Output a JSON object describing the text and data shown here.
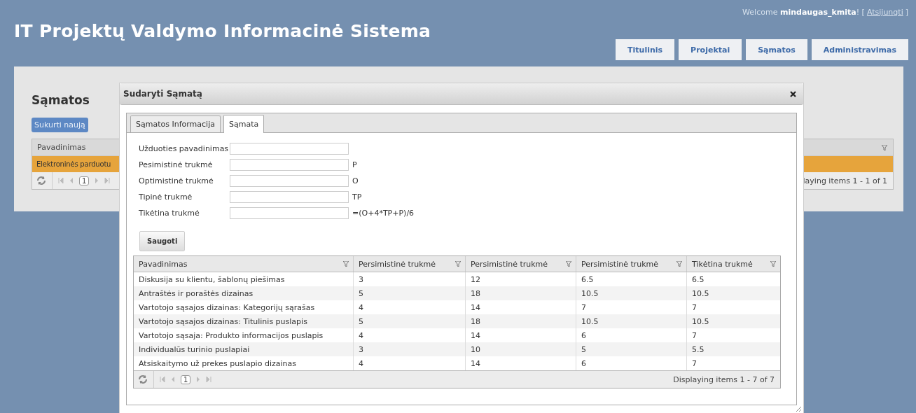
{
  "header": {
    "title": "IT Projektų Valdymo Informacinė Sistema",
    "welcome": "Welcome **mindaugas_kmita**! [",
    "logout_link": "Atsijungti",
    "welcome_end": "]"
  },
  "nav": [
    {
      "label": "Titulinis"
    },
    {
      "label": "Projektai"
    },
    {
      "label": "Sąmatos"
    },
    {
      "label": "Administravimas"
    }
  ],
  "page": {
    "heading": "Sąmatos",
    "create_button": "Sukurti naują",
    "grid": {
      "columns": [
        "Pavadinimas"
      ],
      "rows": [
        {
          "cells": [
            "Elektroninės parduotu"
          ],
          "selected": true
        }
      ],
      "pager": {
        "page": "1",
        "info": "laying items 1 - 1 of 1"
      }
    }
  },
  "dialog": {
    "title": "Sudaryti Sąmatą",
    "tabs": [
      {
        "label": "Sąmatos Informacija",
        "selected": false
      },
      {
        "label": "Sąmata",
        "selected": true
      }
    ],
    "fields": [
      {
        "label": "Užduoties pavadinimas"
      },
      {
        "label": "Pesimistinė trukmė",
        "suffix": "P"
      },
      {
        "label": "Optimistinė trukmė",
        "suffix": "O"
      },
      {
        "label": "Tipinė trukmė",
        "suffix": "TP"
      },
      {
        "label": "Tikėtina trukmė",
        "suffix": "=(O+4*TP+P)/6"
      }
    ],
    "save_button": "Saugoti",
    "grid": {
      "columns": [
        "Pavadinimas",
        "Persimistinė trukmė",
        "Persimistinė trukmė",
        "Persimistinė trukmė",
        "Tikėtina trukmė"
      ],
      "rows": [
        [
          "Diskusija su klientu, šablonų piešimas",
          "3",
          "12",
          "6.5",
          "6.5"
        ],
        [
          "Antraštės ir poraštės dizainas",
          "5",
          "18",
          "10.5",
          "10.5"
        ],
        [
          "Vartotojo sąsajos dizainas: Kategorijų sąrašas",
          "4",
          "14",
          "7",
          "7"
        ],
        [
          "Vartotojo sąsajos dizainas: Titulinis puslapis",
          "5",
          "18",
          "10.5",
          "10.5"
        ],
        [
          "Vartotojo sąsaja: Produkto informacijos puslapis",
          "4",
          "14",
          "6",
          "7"
        ],
        [
          "Individualūs turinio puslapiai",
          "3",
          "10",
          "5",
          "5.5"
        ],
        [
          "Atsiskaitymo už prekes puslapio dizainas",
          "4",
          "14",
          "6",
          "7"
        ]
      ],
      "pager": {
        "page": "1",
        "info": "Displaying items 1 - 7 of 7"
      }
    }
  }
}
